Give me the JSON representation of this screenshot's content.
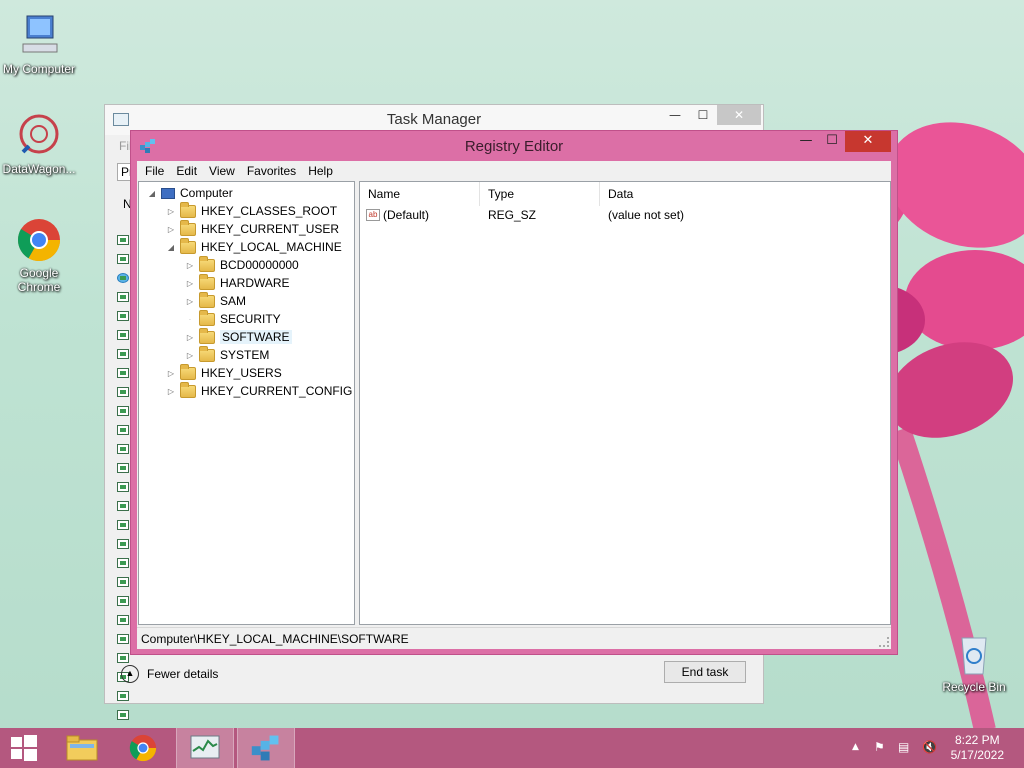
{
  "desktop": {
    "icons": [
      {
        "label": "My Computer"
      },
      {
        "label": "DataWagon..."
      },
      {
        "label": "Google Chrome"
      },
      {
        "label": "Recycle Bin"
      }
    ]
  },
  "task_manager": {
    "title": "Task Manager",
    "fewer_details_label": "Fewer details",
    "end_task_label": "End task",
    "frag_file": "Fil",
    "frag_pr": "Pr",
    "frag_n": "N"
  },
  "registry_editor": {
    "title": "Registry Editor",
    "menu": [
      "File",
      "Edit",
      "View",
      "Favorites",
      "Help"
    ],
    "tree": {
      "root": "Computer",
      "nodes": [
        "HKEY_CLASSES_ROOT",
        "HKEY_CURRENT_USER",
        "HKEY_LOCAL_MACHINE",
        "BCD00000000",
        "HARDWARE",
        "SAM",
        "SECURITY",
        "SOFTWARE",
        "SYSTEM",
        "HKEY_USERS",
        "HKEY_CURRENT_CONFIG"
      ]
    },
    "columns": [
      "Name",
      "Type",
      "Data"
    ],
    "values": [
      {
        "name": "(Default)",
        "type": "REG_SZ",
        "data": "(value not set)"
      }
    ],
    "status_path": "Computer\\HKEY_LOCAL_MACHINE\\SOFTWARE"
  },
  "taskbar": {
    "time": "8:22 PM",
    "date": "5/17/2022"
  },
  "colors": {
    "accent": "#dc6fa6",
    "taskbar": "#b4587f",
    "close_button": "#c7372f"
  }
}
